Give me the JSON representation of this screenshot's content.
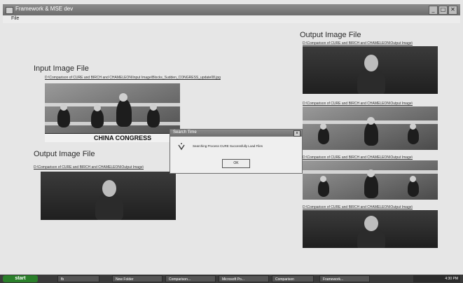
{
  "window": {
    "title": "Framework & MSE dev",
    "minimize": "_",
    "maximize": "□",
    "close": "✕"
  },
  "menu": {
    "file": "File"
  },
  "left": {
    "input_heading": "Input Image File",
    "input_path": "D:\\Comparison of CURE and BIRCH and CHAMELEON\\Input Image\\Blocks_Sudden_CONGRESS_update08.jpg",
    "caption": "CHINA CONGRESS",
    "output_heading": "Output Image File",
    "output_path": "D:\\Comparison of CURE and BIRCH and CHAMELEON\\Output Image\\"
  },
  "right": {
    "output_heading": "Output Image File",
    "paths": [
      "D:\\Comparison of CURE and BIRCH and CHAMELEON\\Output Image\\",
      "D:\\Comparison of CURE and BIRCH and CHAMELEON\\Output Image\\",
      "D:\\Comparison of CURE and BIRCH and CHAMELEON\\Output Image\\",
      "D:\\Comparison of CURE and BIRCH and CHAMELEON\\Output Image\\"
    ]
  },
  "dialog": {
    "title": "Search Time",
    "message": "Searching Process CURE Successfully Load Files",
    "ok": "OK",
    "close": "x"
  },
  "taskbar": {
    "start": "start",
    "items": [
      "fb",
      "New Folder",
      "Comparison...",
      "Microsoft Po...",
      "Comparison",
      "Framework..."
    ],
    "clock": "4:30 PM"
  },
  "colors": {
    "titlebar": "#7a7a7a",
    "taskbar": "#3a3a3a",
    "start": "#2a7f2a"
  }
}
